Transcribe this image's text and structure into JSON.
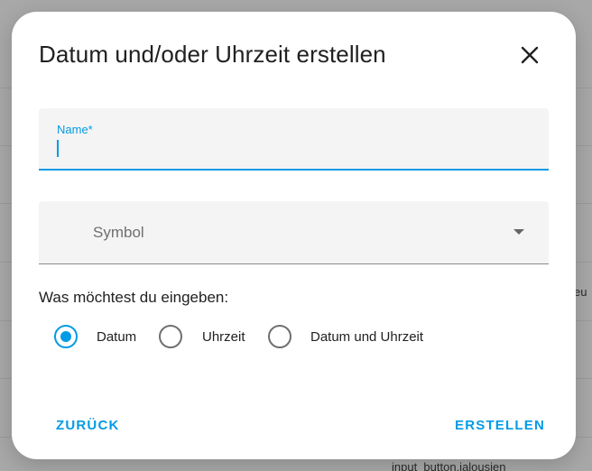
{
  "background": {
    "right_fragment": "eu",
    "bottom_fragment": "input_button.jalousien"
  },
  "dialog": {
    "title": "Datum und/oder Uhrzeit erstellen",
    "close_icon": "close-icon",
    "name_field": {
      "label": "Name*",
      "value": ""
    },
    "symbol_field": {
      "label": "Symbol",
      "icon": "chevron-down-icon"
    },
    "question": "Was möchtest du eingeben:",
    "options": [
      {
        "label": "Datum",
        "checked": true
      },
      {
        "label": "Uhrzeit",
        "checked": false
      },
      {
        "label": "Datum und Uhrzeit",
        "checked": false
      }
    ],
    "back_label": "ZURÜCK",
    "create_label": "ERSTELLEN"
  },
  "colors": {
    "accent": "#039be5",
    "overlay": "#a6a6a6"
  }
}
